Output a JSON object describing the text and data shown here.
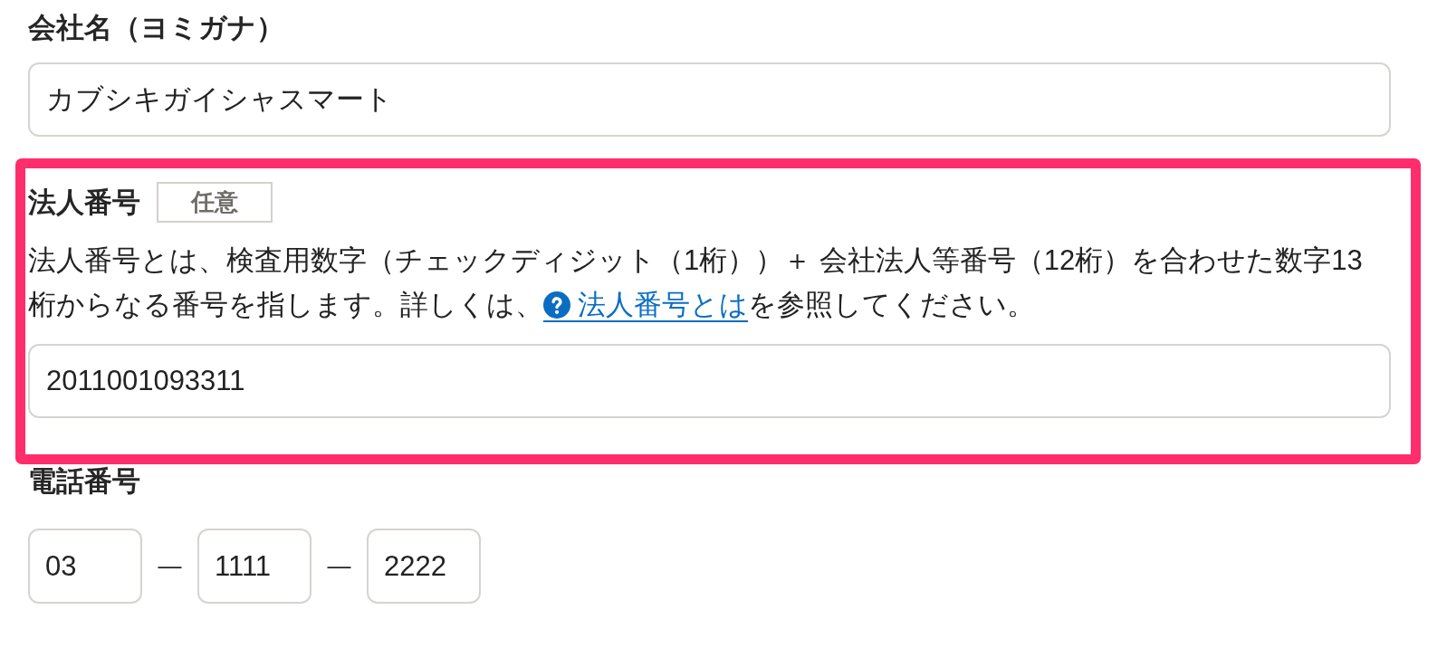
{
  "form": {
    "fields": [
      {
        "kind": "text",
        "label": "会社名（ヨミガナ）",
        "value": "カブシキガイシャスマート",
        "highlighted": false
      },
      {
        "kind": "text",
        "label": "法人番号",
        "badge": "任意",
        "highlighted": true,
        "description": [
          {
            "kind": "text",
            "text": "法人番号とは、検査用数字（チェックディジット（1桁））＋ 会社法人等番号（12桁）を合わせた数字13桁からなる番号を指します。詳しくは、"
          },
          {
            "kind": "link",
            "text": "法人番号とは"
          },
          {
            "kind": "text",
            "text": "を参照してください。"
          }
        ],
        "value": "2011001093311"
      },
      {
        "kind": "phone",
        "label": "電話番号",
        "highlighted": false,
        "parts": [
          {
            "kind": "input",
            "value": "03"
          },
          {
            "kind": "separator",
            "text": "—"
          },
          {
            "kind": "input",
            "value": "1111"
          },
          {
            "kind": "separator",
            "text": "—"
          },
          {
            "kind": "input",
            "value": "2222"
          }
        ]
      }
    ]
  }
}
